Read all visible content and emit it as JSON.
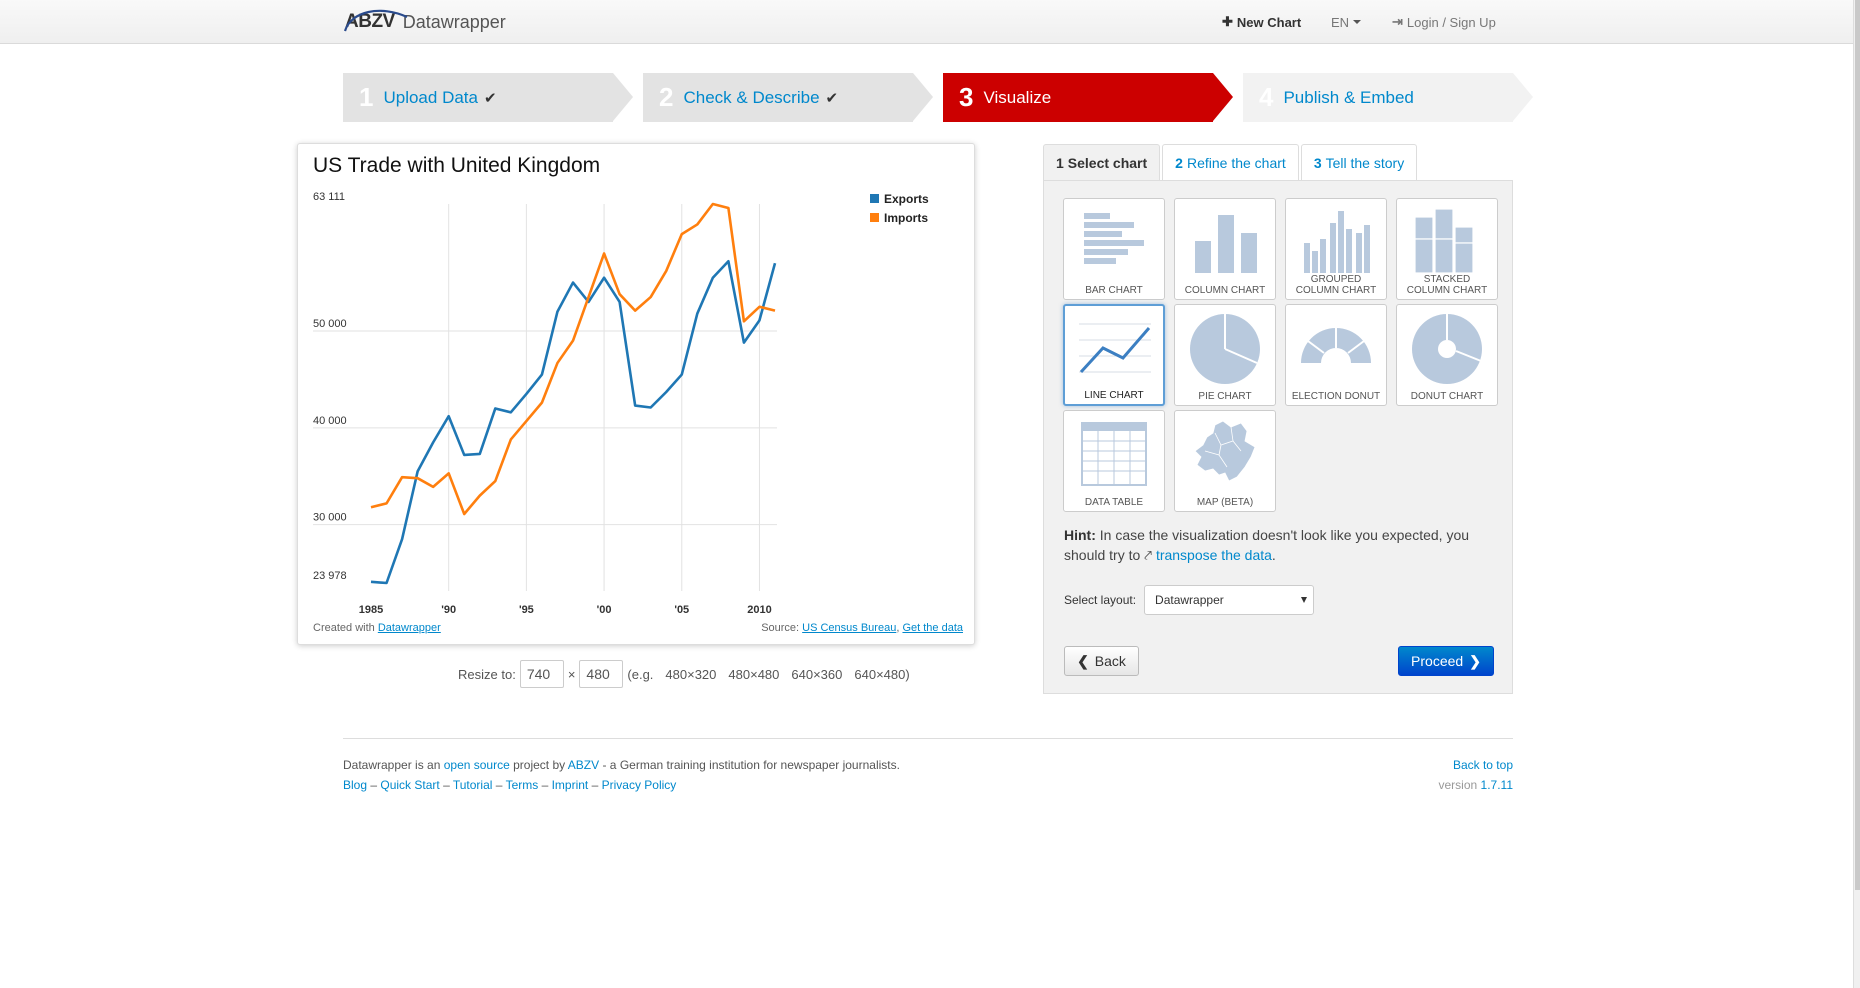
{
  "navbar": {
    "logo_text": "ABZV",
    "app_name": "Datawrapper",
    "new_chart": "New Chart",
    "language": "EN",
    "login": "Login / Sign Up",
    "icons": {
      "new_chart": "plus-icon",
      "login": "login-icon"
    }
  },
  "steps": [
    {
      "num": "1",
      "label": "Upload Data",
      "done": true
    },
    {
      "num": "2",
      "label": "Check & Describe",
      "done": true
    },
    {
      "num": "3",
      "label": "Visualize",
      "active": true
    },
    {
      "num": "4",
      "label": "Publish & Embed"
    }
  ],
  "check_mark": "✔",
  "chart": {
    "title": "US Trade with United Kingdom",
    "created_with_prefix": "Created with ",
    "created_with_link": "Datawrapper",
    "source_prefix": "Source: ",
    "source_link": "US Census Bureau",
    "source_sep": ", ",
    "get_data": "Get the data"
  },
  "chart_data": {
    "type": "line",
    "title": "US Trade with United Kingdom",
    "x": [
      1985,
      1986,
      1987,
      1988,
      1989,
      1990,
      1991,
      1992,
      1993,
      1994,
      1995,
      1996,
      1997,
      1998,
      1999,
      2000,
      2001,
      2002,
      2003,
      2004,
      2005,
      2006,
      2007,
      2008,
      2009,
      2010,
      2011
    ],
    "x_tick_labels": [
      {
        "x": 1985,
        "label": "1985"
      },
      {
        "x": 1990,
        "label": "'90"
      },
      {
        "x": 1995,
        "label": "'95"
      },
      {
        "x": 2000,
        "label": "'00"
      },
      {
        "x": 2005,
        "label": "'05"
      },
      {
        "x": 2010,
        "label": "2010"
      }
    ],
    "y_tick_labels": [
      {
        "y": 63111,
        "label": "63 111"
      },
      {
        "y": 50000,
        "label": "50 000"
      },
      {
        "y": 40000,
        "label": "40 000"
      },
      {
        "y": 30000,
        "label": "30 000"
      },
      {
        "y": 23978,
        "label": "23 978"
      }
    ],
    "ylim": [
      23978,
      63111
    ],
    "grid": true,
    "legend_position": "top-right",
    "series": [
      {
        "name": "Exports",
        "color": "#1f77b4",
        "values": [
          24100,
          23978,
          28500,
          35500,
          38500,
          41200,
          37200,
          37300,
          42000,
          41600,
          43500,
          45500,
          52000,
          55000,
          53000,
          55500,
          53000,
          42300,
          42100,
          43700,
          45500,
          51800,
          55500,
          57200,
          48800,
          51100,
          57000
        ]
      },
      {
        "name": "Imports",
        "color": "#ff7f0e",
        "values": [
          31800,
          32200,
          34900,
          34800,
          33900,
          35300,
          31100,
          33000,
          34500,
          38800,
          40700,
          42600,
          46700,
          49000,
          53500,
          58000,
          53800,
          52100,
          53500,
          56200,
          60000,
          61000,
          63111,
          62700,
          51000,
          52500,
          52100
        ]
      }
    ]
  },
  "resize": {
    "label": "Resize to:",
    "width": "740",
    "height": "480",
    "times": "×",
    "eg_open": "(e.g.",
    "presets": [
      "480×320",
      "480×480",
      "640×360",
      "640×480)"
    ]
  },
  "tabs": [
    {
      "num": "1",
      "label": "Select chart",
      "active": true
    },
    {
      "num": "2",
      "label": "Refine the chart"
    },
    {
      "num": "3",
      "label": "Tell the story"
    }
  ],
  "chart_types": [
    {
      "label": "BAR CHART",
      "icon": "bar-chart-icon"
    },
    {
      "label": "COLUMN CHART",
      "icon": "column-chart-icon"
    },
    {
      "label": "GROUPED\nCOLUMN CHART",
      "icon": "grouped-column-chart-icon"
    },
    {
      "label": "STACKED\nCOLUMN CHART",
      "icon": "stacked-column-chart-icon"
    },
    {
      "label": "LINE CHART",
      "icon": "line-chart-icon",
      "selected": true
    },
    {
      "label": "PIE CHART",
      "icon": "pie-chart-icon"
    },
    {
      "label": "ELECTION DONUT",
      "icon": "election-donut-icon"
    },
    {
      "label": "DONUT CHART",
      "icon": "donut-chart-icon"
    },
    {
      "label": "DATA TABLE",
      "icon": "data-table-icon"
    },
    {
      "label": "MAP (BETA)",
      "icon": "map-icon"
    }
  ],
  "hint": {
    "bold": "Hint:",
    "text": " In case the visualization doesn't look like you expected, you should try to ",
    "link": "transpose the data",
    "end": "."
  },
  "layout_select": {
    "label": "Select layout:",
    "value": "Datawrapper"
  },
  "buttons": {
    "back": "Back",
    "proceed": "Proceed"
  },
  "footer": {
    "t1": "Datawrapper is an ",
    "open_source": "open source",
    "t2": " project by ",
    "abzv": "ABZV",
    "t3": " - a German training institution for newspaper journalists.",
    "links": [
      "Blog",
      "Quick Start",
      "Tutorial",
      "Terms",
      "Imprint",
      "Privacy Policy"
    ],
    "sep": " – ",
    "back_to_top": "Back to top",
    "version_label": "version ",
    "version": "1.7.11"
  },
  "colors": {
    "accent_red": "#cc0000",
    "link_blue": "#0088cc",
    "exports": "#1f77b4",
    "imports": "#ff7f0e",
    "icon_fill": "#b8c9dd"
  }
}
